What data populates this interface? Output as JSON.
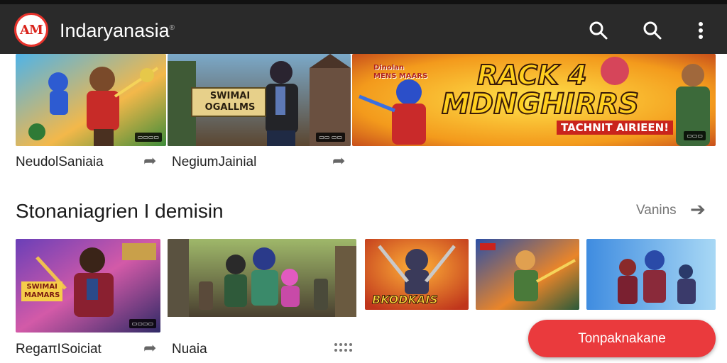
{
  "header": {
    "logo_text": "AM",
    "title": "Indaryanasia",
    "title_mark": "®",
    "icons": [
      "search-icon",
      "search-icon",
      "more-vert-icon"
    ]
  },
  "row1": {
    "items": [
      {
        "caption": "NeudolSaniaia",
        "badge": "▭▭▭▭"
      },
      {
        "caption": "NegiumJainial",
        "overlay": "SWIMAI\nOGALLMS",
        "badge": "▭▭ ▭▭"
      },
      {
        "banner_small": "Dinolan\nMENS MAARS",
        "banner_line1": "RACK 4",
        "banner_line2": "MDNGHIRRS",
        "banner_line3": "TACHNIT AIRIEEN!",
        "badge": "▭▭▭"
      }
    ]
  },
  "section": {
    "title": "Stonaniagrien I demisin",
    "view_all": "Vanins"
  },
  "row2": {
    "items": [
      {
        "caption": "RegaπISoiciat",
        "overlay": "SWIMAI\nMAMARS",
        "badge": "▭▭▭▭"
      },
      {
        "caption": "Nuaia"
      },
      {
        "overlay": "BKODKAIS"
      },
      {},
      {}
    ]
  },
  "fab": {
    "label": "Tonpaknakane"
  },
  "colors": {
    "topbar": "#2a2a2a",
    "accent": "#ea3a3d",
    "logo_red": "#d9231b"
  }
}
